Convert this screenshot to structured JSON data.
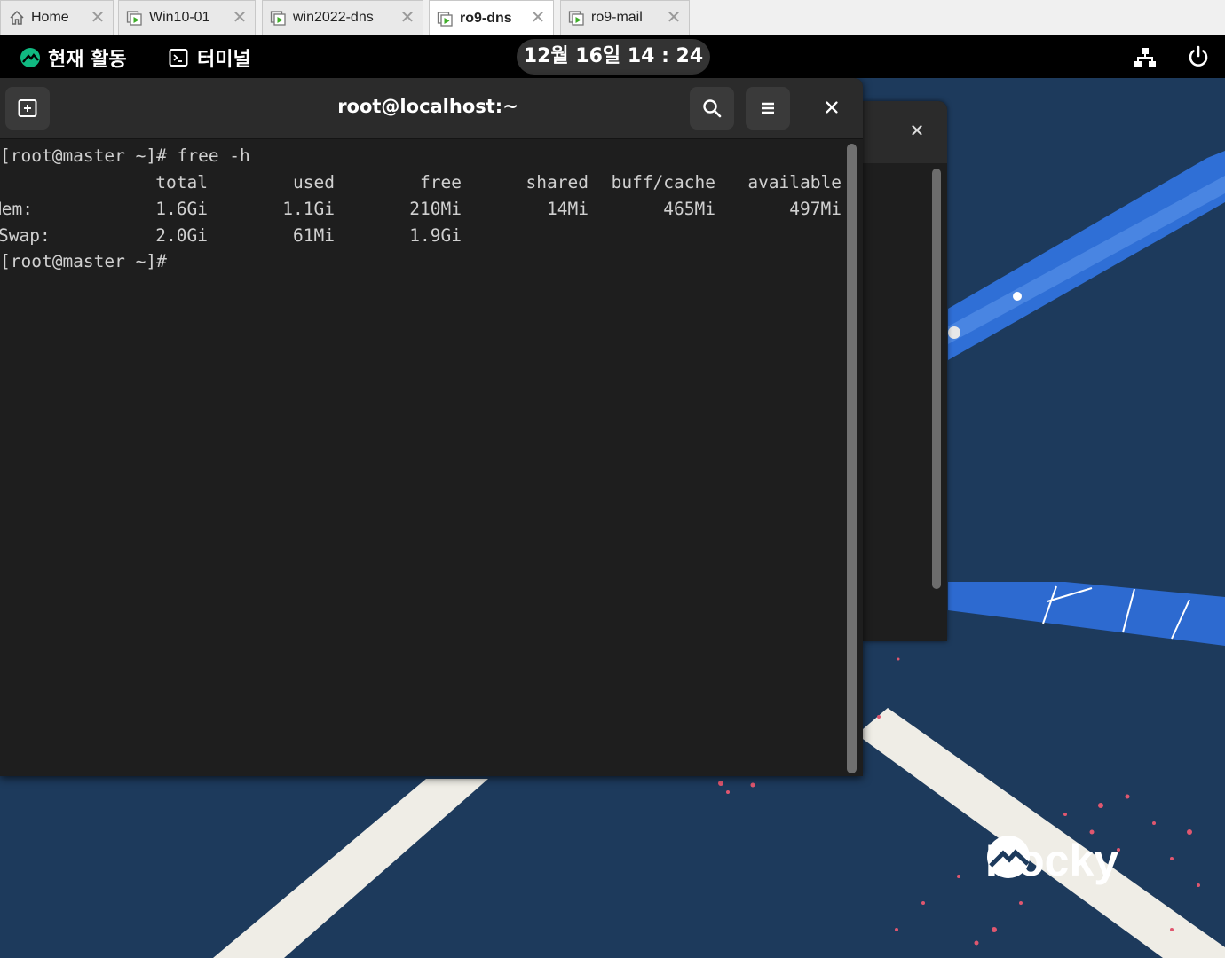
{
  "tabs": [
    {
      "label": "Home",
      "icon": "home-icon",
      "active": false
    },
    {
      "label": "Win10-01",
      "icon": "vm-icon",
      "active": false
    },
    {
      "label": "win2022-dns",
      "icon": "vm-icon",
      "active": false
    },
    {
      "label": "ro9-dns",
      "icon": "vm-icon",
      "active": true
    },
    {
      "label": "ro9-mail",
      "icon": "vm-icon",
      "active": false
    }
  ],
  "topbar": {
    "activities_label": "현재 활동",
    "app_label": "터미널",
    "clock": "12월 16일 14 : 24"
  },
  "terminal": {
    "title": "root@localhost:~",
    "prompt": "[root@master ~]#",
    "command": "free -h",
    "headers": [
      "total",
      "used",
      "free",
      "shared",
      "buff/cache",
      "available"
    ],
    "rows": [
      {
        "label": "Mem:",
        "values": [
          "1.6Gi",
          "1.1Gi",
          "210Mi",
          "14Mi",
          "465Mi",
          "497Mi"
        ]
      },
      {
        "label": "Swap:",
        "values": [
          "2.0Gi",
          "61Mi",
          "1.9Gi",
          "",
          "",
          ""
        ]
      }
    ],
    "final_prompt": "[root@master ~]#"
  },
  "wallpaper": {
    "brand": "Rocky"
  },
  "colors": {
    "desktop_bg": "#1d3a5c",
    "terminal_bg": "#1e1e1e",
    "headerbar_bg": "#2b2b2b",
    "accent_green": "#10b981"
  }
}
